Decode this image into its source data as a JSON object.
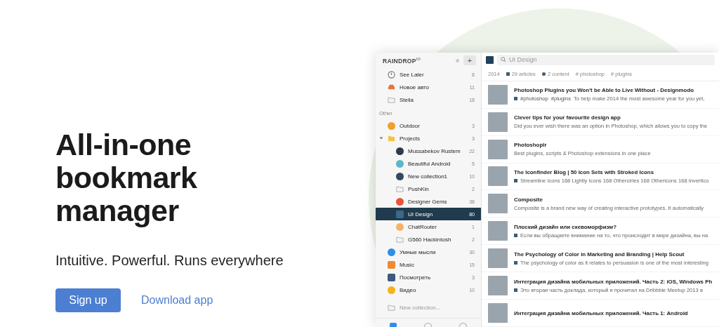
{
  "hero": {
    "heading": "All-in-one bookmark manager",
    "subtitle": "Intuitive. Powerful. Runs everywhere",
    "primary_button": "Sign up",
    "link": "Download app"
  },
  "app": {
    "sidebar": {
      "logo": "RAINDROP",
      "logo_version": "IO",
      "add_button": "+",
      "items": [
        {
          "kind": "clock",
          "label": "See Later",
          "count": "8",
          "selected": false
        },
        {
          "kind": "car",
          "label": "Новое авто",
          "count": "11",
          "selected": false
        },
        {
          "kind": "folder",
          "label": "Stella",
          "count": "18",
          "selected": false
        },
        {
          "kind": "section",
          "label": "Other"
        },
        {
          "kind": "round",
          "color": "#f0a030",
          "label": "Outdoor",
          "count": "3",
          "selected": false
        },
        {
          "kind": "yellow-folder",
          "label": "Projects",
          "count": "3",
          "selected": false,
          "expanded": true,
          "children": [
            {
              "kind": "round",
              "color": "#2e3a46",
              "label": "Mussabekov Rustem",
              "count": "22",
              "selected": false
            },
            {
              "kind": "round",
              "color": "#5bb8c8",
              "label": "Beautiful Android",
              "count": "5",
              "selected": false
            },
            {
              "kind": "round",
              "color": "#34495e",
              "label": "New collection1",
              "count": "10",
              "selected": false
            },
            {
              "kind": "folder",
              "label": "PushKin",
              "count": "2",
              "selected": false
            },
            {
              "kind": "round",
              "color": "#e8553a",
              "label": "Designer Gems",
              "count": "38",
              "selected": false
            },
            {
              "kind": "square",
              "color": "#3a6a8a",
              "label": "UI Design",
              "count": "80",
              "selected": true
            },
            {
              "kind": "round",
              "color": "#f5b26b",
              "label": "ChatRouter",
              "count": "1",
              "selected": false
            },
            {
              "kind": "folder",
              "label": "G560 Hackintosh",
              "count": "2",
              "selected": false
            }
          ]
        },
        {
          "kind": "round",
          "color": "#2f8fe8",
          "label": "Умные мысли",
          "count": "30",
          "selected": false
        },
        {
          "kind": "square",
          "color": "#f08a30",
          "label": "Music",
          "count": "15",
          "selected": false
        },
        {
          "kind": "square",
          "color": "#3d5a80",
          "label": "Посмотреть",
          "count": "3",
          "selected": false
        },
        {
          "kind": "round",
          "color": "#f5b316",
          "label": "Видео",
          "count": "10",
          "selected": false
        }
      ],
      "new_collection": "New collection..."
    },
    "search": {
      "value": "UI Design"
    },
    "meta": {
      "year": "2014",
      "articles": "29 articles",
      "content": "2 content",
      "tags": [
        "# photoshop",
        "# plugins"
      ]
    },
    "articles": [
      {
        "title": "Photoshop Plugins you Won't be Able to Live Without - Designmodo",
        "tags": [
          "#photoshop",
          "#plugins"
        ],
        "description": "To help make 2014 the most awesome year for you yet,",
        "article_icon": true
      },
      {
        "title": "Clever tips for your favourite design app",
        "description": "Did you ever wish there was an option in Photoshop, which allows you to copy the",
        "article_icon": false
      },
      {
        "title": "Photoshoplr",
        "description": "Best plugins, scripts & Photoshop extensions in one place",
        "article_icon": false
      },
      {
        "title": "The Iconfinder Blog | 50 Icon Sets with Stroked Icons",
        "description": "Streamline Icons 168 Lightly Icons 168 Othercirles 168 Othericons 168 Invertico",
        "article_icon": true
      },
      {
        "title": "Composite",
        "description": "Composite is a brand new way of creating interactive prototypes. It automatically",
        "article_icon": false
      },
      {
        "title": "Плоский дизайн или скевоморфизм?",
        "description": "Если вы обращаете внимание на то, что происходит в мире дизайна, вы на",
        "article_icon": true
      },
      {
        "title": "The Psychology of Color in Marketing and Branding | Help Scout",
        "description": "The psychology of color as it relates to persuasion is one of the most interesting",
        "article_icon": true
      },
      {
        "title": "Интеграция дизайна мобильных приложений. Часть 2: iOS, Windows Ph",
        "description": "Это вторая часть доклада, который я прочитал на Dribbble Meetup 2013 в",
        "article_icon": true
      },
      {
        "title": "Интеграция дизайна мобильных приложений. Часть 1: Android",
        "article_icon": false
      }
    ]
  }
}
